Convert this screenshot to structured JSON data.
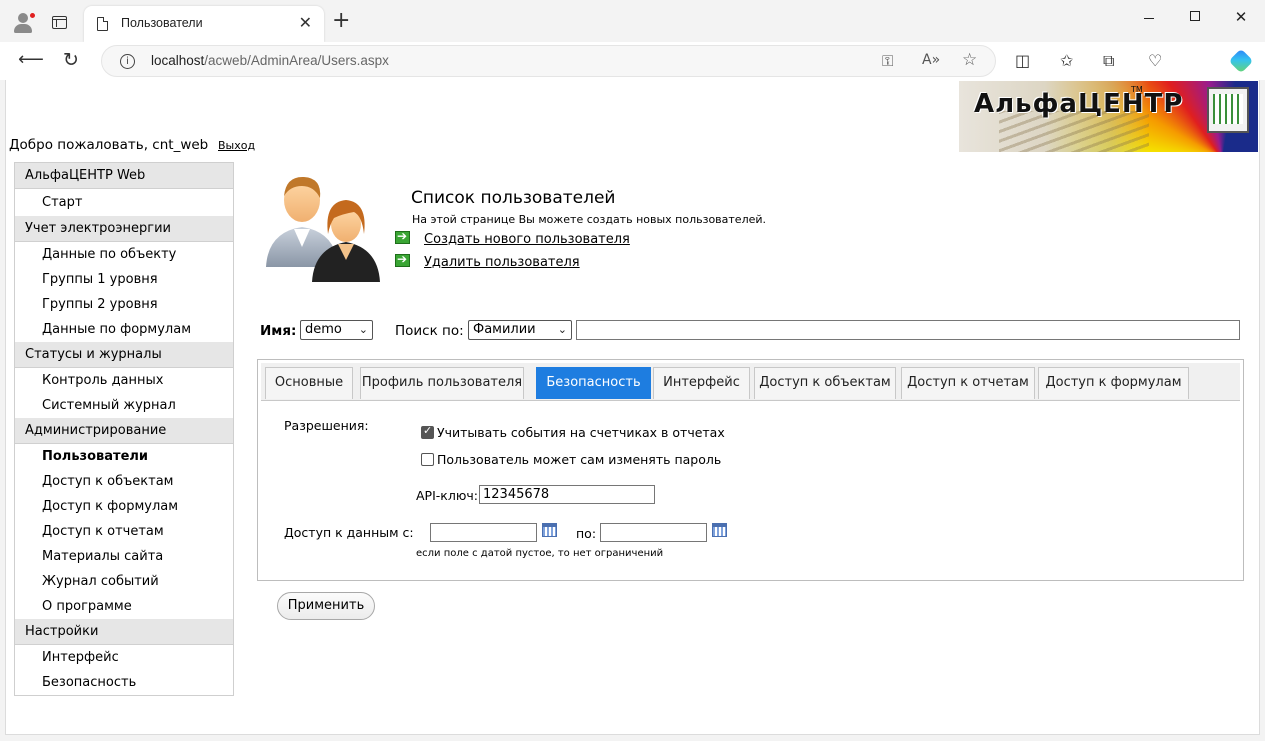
{
  "browser": {
    "tab_title": "Пользователи",
    "tab_close": "✕",
    "new_tab": "+",
    "url_host": "localhost",
    "url_path": "/acweb/AdminArea/Users.aspx",
    "icons": [
      "profile-icon",
      "tab-actions-icon",
      "page-icon",
      "back-icon",
      "reload-icon",
      "info-icon",
      "key-icon",
      "read-aloud-icon",
      "favorite-star-icon",
      "split-screen-icon",
      "favorites-icon",
      "collections-icon",
      "browser-essentials-icon",
      "copilot-icon"
    ]
  },
  "header": {
    "logo_text": "АльфаЦЕНТР",
    "logo_tm": "TM",
    "welcome": "Добро пожаловать, cnt_web",
    "logout": "Выход"
  },
  "sidebar": {
    "sections": [
      {
        "title": "АльфаЦЕНТР Web",
        "items": [
          "Старт"
        ]
      },
      {
        "title": "Учет электроэнергии",
        "items": [
          "Данные по объекту",
          "Группы 1 уровня",
          "Группы 2 уровня",
          "Данные по формулам"
        ]
      },
      {
        "title": "Статусы и журналы",
        "items": [
          "Контроль данных",
          "Системный журнал"
        ]
      },
      {
        "title": "Администрирование",
        "items": [
          "Пользователи",
          "Доступ к объектам",
          "Доступ к формулам",
          "Доступ к отчетам",
          "Материалы сайта",
          "Журнал событий",
          "О программе"
        ]
      },
      {
        "title": "Настройки",
        "items": [
          "Интерфейс",
          "Безопасность"
        ]
      }
    ],
    "active_item": "Пользователи"
  },
  "main": {
    "title": "Список пользователей",
    "description": "На этой странице Вы можете создать новых пользователей.",
    "create_link": "Создать нового пользователя",
    "delete_link": "Удалить пользователя",
    "name_label": "Имя:",
    "name_value": "demo",
    "search_label": "Поиск по:",
    "search_by_value": "Фамилии",
    "search_text": "",
    "tabs": [
      {
        "label": "Основные",
        "active": false
      },
      {
        "label": "Профиль пользователя",
        "active": false
      },
      {
        "label": "Безопасность",
        "active": true
      },
      {
        "label": "Интерфейс",
        "active": false
      },
      {
        "label": "Доступ к объектам",
        "active": false
      },
      {
        "label": "Доступ к отчетам",
        "active": false
      },
      {
        "label": "Доступ к формулам",
        "active": false
      }
    ],
    "security": {
      "permissions_label": "Разрешения:",
      "checkbox1_label": "Учитывать события на счетчиках в отчетах",
      "checkbox1_checked": true,
      "checkbox2_label": "Пользователь может сам изменять пароль",
      "checkbox2_checked": false,
      "api_key_label": "API-ключ:",
      "api_key_value": "12345678",
      "access_label": "Доступ к данным с:",
      "to_label": "по:",
      "date_from": "",
      "date_to": "",
      "hint": "если поле с датой пустое, то нет ограничений"
    },
    "apply_button": "Применить"
  },
  "colors": {
    "active_tab": "#1e7de0",
    "sidebar_header": "#e6e6e6",
    "link_arrow": "#3aa534"
  }
}
